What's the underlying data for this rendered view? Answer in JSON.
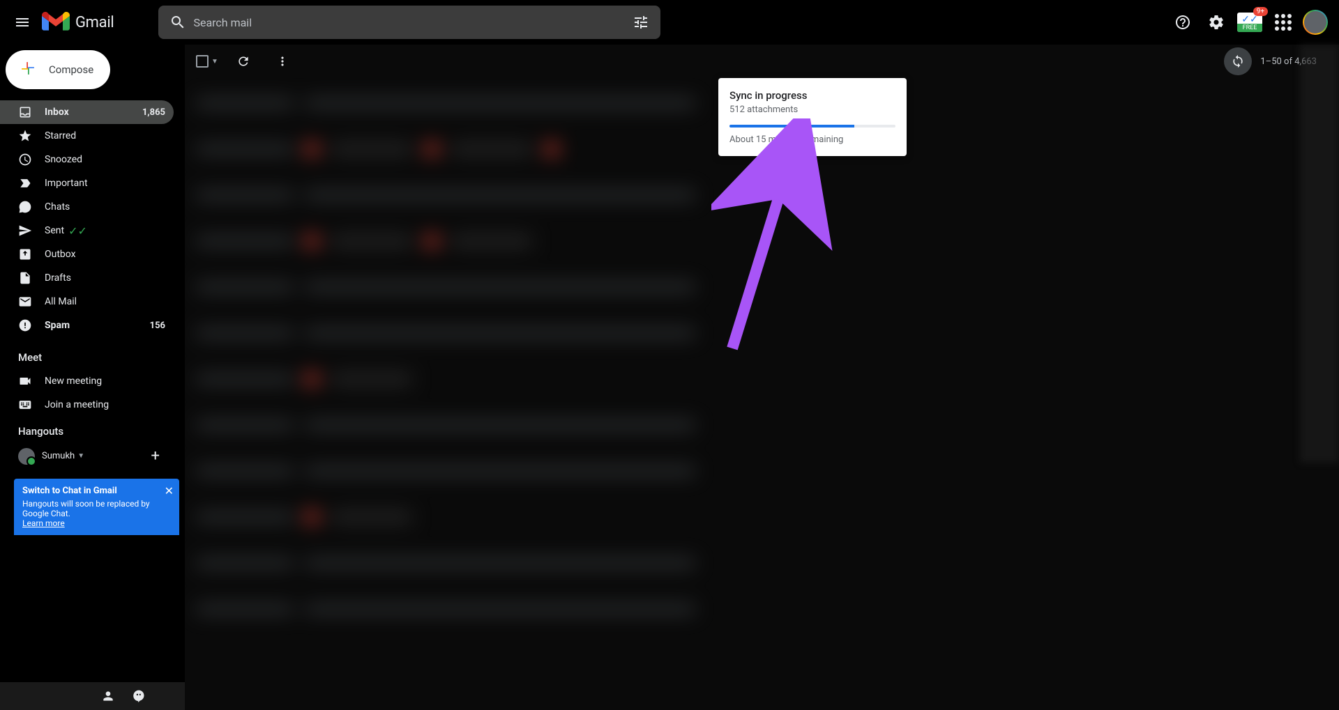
{
  "header": {
    "app_name": "Gmail",
    "search_placeholder": "Search mail",
    "notification_badge": "9+",
    "free_label": "FREE"
  },
  "compose_label": "Compose",
  "sidebar": {
    "items": [
      {
        "icon": "inbox",
        "label": "Inbox",
        "count": "1,865",
        "active": true,
        "bold": true
      },
      {
        "icon": "star",
        "label": "Starred"
      },
      {
        "icon": "clock",
        "label": "Snoozed"
      },
      {
        "icon": "important",
        "label": "Important"
      },
      {
        "icon": "chat",
        "label": "Chats"
      },
      {
        "icon": "sent",
        "label": "Sent",
        "checkmarks": true
      },
      {
        "icon": "outbox",
        "label": "Outbox"
      },
      {
        "icon": "draft",
        "label": "Drafts"
      },
      {
        "icon": "allmail",
        "label": "All Mail"
      },
      {
        "icon": "spam",
        "label": "Spam",
        "count": "156",
        "bold": true
      }
    ],
    "meet_header": "Meet",
    "meet_items": [
      {
        "icon": "camera",
        "label": "New meeting"
      },
      {
        "icon": "keyboard",
        "label": "Join a meeting"
      }
    ],
    "hangouts_header": "Hangouts",
    "hangouts_user": "Sumukh"
  },
  "chat_banner": {
    "title": "Switch to Chat in Gmail",
    "body": "Hangouts will soon be replaced by Google Chat.",
    "learn_more": "Learn more"
  },
  "toolbar": {
    "page_info": "1–50 of 4,663"
  },
  "sync_popover": {
    "title": "Sync in progress",
    "subtitle": "512 attachments",
    "progress_percent": 75,
    "eta": "About 15 minutes remaining"
  }
}
